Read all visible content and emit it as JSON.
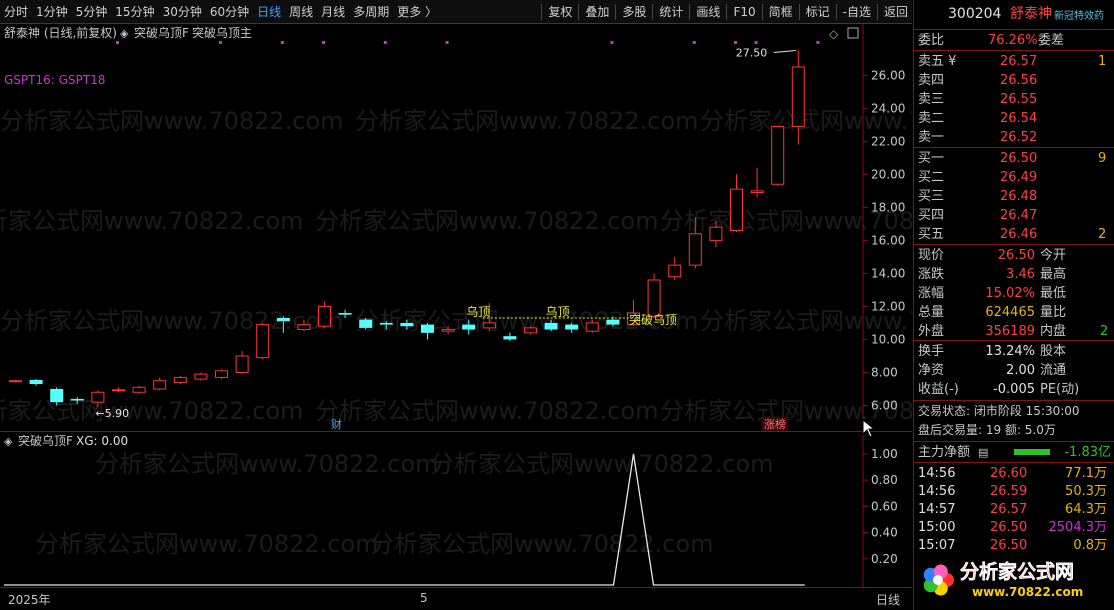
{
  "toolbar": {
    "left_items": [
      "分时",
      "1分钟",
      "5分钟",
      "15分钟",
      "30分钟",
      "60分钟",
      "日线",
      "周线",
      "月线",
      "多周期",
      "更多 〉"
    ],
    "active": "日线",
    "right_items": [
      "复权",
      "叠加",
      "多股",
      "统计",
      "画线",
      "F10",
      "简框",
      "标记",
      "-自选",
      "返回"
    ]
  },
  "chart_header": {
    "stock_title": "舒泰神 (日线,前复权)",
    "formula_main": "突破乌顶F",
    "formula_sub": "突破乌顶主",
    "gspt_label": "GSPT16:  GSPT18"
  },
  "watermark": "分析家公式网www.70822.com",
  "price_axis_ticks": [
    "26.00",
    "24.00",
    "22.00",
    "20.00",
    "18.00",
    "16.00",
    "14.00",
    "12.00",
    "10.00",
    "8.00",
    "6.00"
  ],
  "annotations": {
    "high_label": "27.50",
    "low_label": "5.90",
    "wu_ding_1": "乌顶",
    "wu_ding_2": "乌顶",
    "break_label": "突破乌顶",
    "fin_badge": "财",
    "zhang_badge": "涨榜"
  },
  "indicator": {
    "title": "突破乌顶F",
    "xg_label": "XG: 0.00",
    "axis_ticks": [
      "1.00",
      "0.80",
      "0.60",
      "0.40",
      "0.20"
    ]
  },
  "date_axis": {
    "start": "2025年",
    "mid": "5",
    "period": "日线"
  },
  "chart_data": {
    "type": "candlestick",
    "y_range": [
      5.0,
      28.5
    ],
    "candles": [
      {
        "o": 7.45,
        "c": 7.5,
        "h": 7.55,
        "l": 7.4
      },
      {
        "o": 7.55,
        "c": 7.3,
        "h": 7.6,
        "l": 7.2
      },
      {
        "o": 7.0,
        "c": 6.2,
        "h": 7.1,
        "l": 6.0
      },
      {
        "o": 6.4,
        "c": 6.3,
        "h": 6.5,
        "l": 6.1
      },
      {
        "o": 6.2,
        "c": 6.8,
        "h": 6.9,
        "l": 5.9
      },
      {
        "o": 6.9,
        "c": 6.95,
        "h": 7.1,
        "l": 6.8
      },
      {
        "o": 6.8,
        "c": 7.1,
        "h": 7.2,
        "l": 6.7
      },
      {
        "o": 7.0,
        "c": 7.5,
        "h": 7.7,
        "l": 6.9
      },
      {
        "o": 7.4,
        "c": 7.7,
        "h": 7.8,
        "l": 7.3
      },
      {
        "o": 7.6,
        "c": 7.9,
        "h": 8.0,
        "l": 7.5
      },
      {
        "o": 7.7,
        "c": 8.1,
        "h": 8.2,
        "l": 7.6
      },
      {
        "o": 8.0,
        "c": 9.0,
        "h": 9.3,
        "l": 7.9
      },
      {
        "o": 8.9,
        "c": 10.9,
        "h": 11.0,
        "l": 8.8
      },
      {
        "o": 11.3,
        "c": 11.1,
        "h": 11.4,
        "l": 10.4
      },
      {
        "o": 10.6,
        "c": 10.9,
        "h": 11.2,
        "l": 10.5
      },
      {
        "o": 10.8,
        "c": 12.0,
        "h": 12.3,
        "l": 10.7
      },
      {
        "o": 11.6,
        "c": 11.5,
        "h": 11.8,
        "l": 11.3
      },
      {
        "o": 11.2,
        "c": 10.7,
        "h": 11.3,
        "l": 10.6
      },
      {
        "o": 11.0,
        "c": 10.9,
        "h": 11.1,
        "l": 10.6
      },
      {
        "o": 11.0,
        "c": 10.8,
        "h": 11.2,
        "l": 10.6
      },
      {
        "o": 10.9,
        "c": 10.4,
        "h": 11.0,
        "l": 10.0
      },
      {
        "o": 10.5,
        "c": 10.6,
        "h": 10.8,
        "l": 10.3
      },
      {
        "o": 10.9,
        "c": 10.6,
        "h": 11.2,
        "l": 10.3
      },
      {
        "o": 10.7,
        "c": 11.0,
        "h": 12.2,
        "l": 10.5
      },
      {
        "o": 10.2,
        "c": 10.0,
        "h": 10.4,
        "l": 9.9
      },
      {
        "o": 10.4,
        "c": 10.7,
        "h": 10.8,
        "l": 10.3
      },
      {
        "o": 11.0,
        "c": 10.6,
        "h": 11.2,
        "l": 10.5
      },
      {
        "o": 10.9,
        "c": 10.6,
        "h": 11.0,
        "l": 10.4
      },
      {
        "o": 10.5,
        "c": 11.0,
        "h": 11.2,
        "l": 10.4
      },
      {
        "o": 11.2,
        "c": 10.9,
        "h": 11.4,
        "l": 10.8
      },
      {
        "o": 10.9,
        "c": 11.6,
        "h": 12.4,
        "l": 10.8
      },
      {
        "o": 11.4,
        "c": 13.6,
        "h": 14.0,
        "l": 11.3
      },
      {
        "o": 13.8,
        "c": 14.5,
        "h": 15.0,
        "l": 13.6
      },
      {
        "o": 14.5,
        "c": 16.4,
        "h": 17.4,
        "l": 14.3
      },
      {
        "o": 16.0,
        "c": 16.8,
        "h": 17.2,
        "l": 15.6
      },
      {
        "o": 16.6,
        "c": 19.1,
        "h": 20.0,
        "l": 16.5
      },
      {
        "o": 18.9,
        "c": 19.0,
        "h": 20.4,
        "l": 18.6
      },
      {
        "o": 19.4,
        "c": 22.9,
        "h": 22.9,
        "l": 19.3
      },
      {
        "o": 22.9,
        "c": 26.5,
        "h": 27.5,
        "l": 21.8
      }
    ],
    "wu_ding_level": 11.3,
    "xg_signal_index": 30
  },
  "quote": {
    "code": "300204",
    "name": "舒泰神",
    "special": "新冠特效药",
    "weibi_label": "委比",
    "weibi_value": "76.26%",
    "weicha_label": "委差",
    "asks": [
      {
        "label": "卖五",
        "price": "26.57",
        "vol": "1"
      },
      {
        "label": "卖四",
        "price": "26.56",
        "vol": ""
      },
      {
        "label": "卖三",
        "price": "26.55",
        "vol": ""
      },
      {
        "label": "卖二",
        "price": "26.54",
        "vol": ""
      },
      {
        "label": "卖一",
        "price": "26.52",
        "vol": ""
      }
    ],
    "bids": [
      {
        "label": "买一",
        "price": "26.50",
        "vol": "9"
      },
      {
        "label": "买二",
        "price": "26.49",
        "vol": ""
      },
      {
        "label": "买三",
        "price": "26.48",
        "vol": ""
      },
      {
        "label": "买四",
        "price": "26.47",
        "vol": ""
      },
      {
        "label": "买五",
        "price": "26.46",
        "vol": "2"
      }
    ],
    "stats1": [
      {
        "l": "现价",
        "v": "26.50",
        "r": "今开"
      },
      {
        "l": "涨跌",
        "v": "3.46",
        "r": "最高"
      },
      {
        "l": "涨幅",
        "v": "15.02%",
        "r": "最低"
      },
      {
        "l": "总量",
        "v": "624465",
        "r": "量比"
      },
      {
        "l": "外盘",
        "v": "356189",
        "r": "内盘",
        "rv": "2"
      }
    ],
    "stats2": [
      {
        "l": "换手",
        "v": "13.24%",
        "r": "股本"
      },
      {
        "l": "净资",
        "v": "2.00",
        "r": "流通"
      },
      {
        "l": "收益(-)",
        "v": "-0.005",
        "r": "PE(动)"
      }
    ],
    "trade_status": "交易状态: 闭市阶段 15:30:00",
    "after_hours": "盘后交易量: 19  额: 5.0万",
    "main_net_label": "主力净额",
    "main_net_value": "-1.83亿",
    "ticks": [
      {
        "t": "14:56",
        "p": "26.60",
        "v": "77.1万"
      },
      {
        "t": "14:56",
        "p": "26.59",
        "v": "50.3万"
      },
      {
        "t": "14:57",
        "p": "26.57",
        "v": "64.3万"
      },
      {
        "t": "15:00",
        "p": "26.50",
        "v": "2504.3万"
      },
      {
        "t": "15:07",
        "p": "26.50",
        "v": "0.8万"
      }
    ],
    "logo_text": "分析家公式网",
    "logo_url": "www.70822.com"
  }
}
